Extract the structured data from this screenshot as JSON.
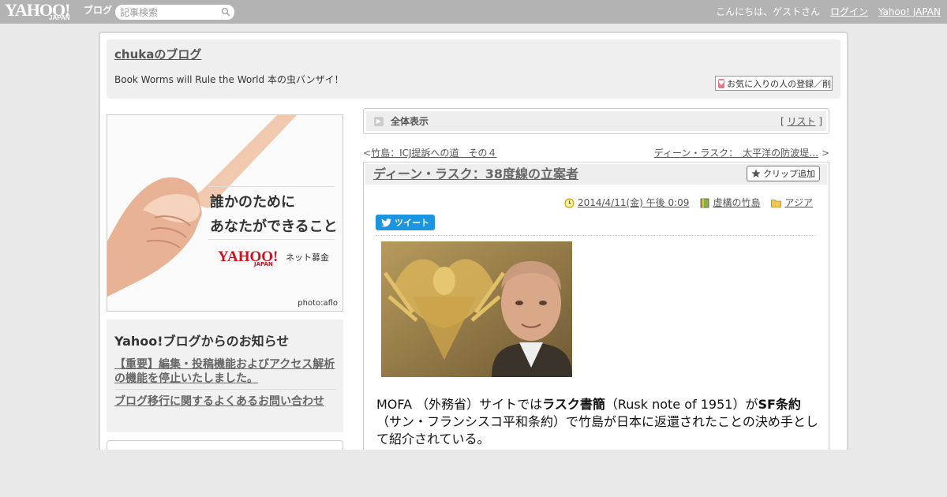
{
  "topbar": {
    "logo_text": "YAHOO!",
    "logo_sub": "JAPAN",
    "logo_blog": "ブログ",
    "search_placeholder": "記事検索",
    "greeting": "こんにちは、ゲストさん",
    "login_label": "ログイン",
    "yahoo_japan_label": "Yahoo! JAPAN"
  },
  "header": {
    "blog_title": "chukaのブログ",
    "blog_description": "Book Worms will Rule the World 本の虫バンザイ！",
    "favorite_button_label": "お気に入りの人の登録／削除"
  },
  "banner": {
    "headline_line1": "誰かのために",
    "headline_line2": "あなたができること",
    "logo_text": "YAHOO!",
    "logo_sub": "JAPAN",
    "net_bokin": "ネット募金",
    "photo_credit": "photo:aflo"
  },
  "notice": {
    "title": "Yahoo!ブログからのお知らせ",
    "items": [
      "【重要】編集・投稿機能およびアクセス解析の機能を停止いたしました。",
      "ブログ移行に関するよくあるお問い合わせ"
    ]
  },
  "view_bar": {
    "label": "全体表示",
    "bracket_open": "[",
    "list_label": "リスト",
    "bracket_close": "]"
  },
  "nav": {
    "prev_arrow": "<",
    "prev_label": "竹島：ICJ提訴への道　その４",
    "next_label": "ディーン・ラスク：　太平洋の防波堤…",
    "next_arrow": ">"
  },
  "article": {
    "title": "ディーン・ラスク：38度線の立案者",
    "clip_button_label": "クリップ追加",
    "date": "2014/4/11(金) 午後 0:09",
    "category1": "虚構の竹島",
    "category2": "アジア",
    "tweet_label": "ツイート",
    "body_part1": "MOFA （外務省）サイトでは",
    "body_bold1": "ラスク書簡",
    "body_part2": "（Rusk note of 1951）が",
    "body_bold2": "SF条約",
    "body_part3": "（サン・フランシスコ平和条約）で竹島が日本に返還されたことの決め手として紹介されている。"
  },
  "colors": {
    "topbar": "#b3b3b3",
    "tweet": "#1b95e0",
    "banner_logo": "#d01020"
  }
}
